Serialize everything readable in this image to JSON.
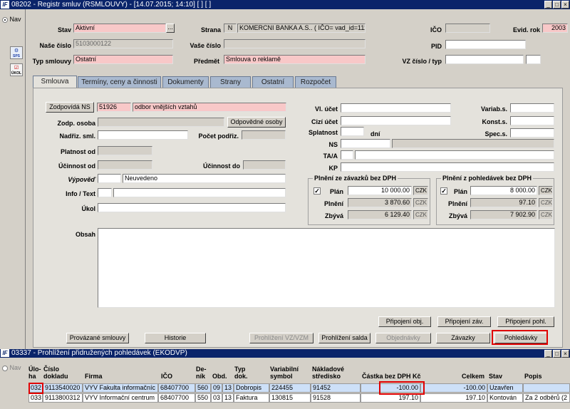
{
  "window": {
    "title": "08202 - Registr smluv (RSMLOUVY) - [14.07.2015; 14:10]  [ ]  [ ]",
    "logo": "IF"
  },
  "left": {
    "nav_label": "Nav",
    "icons": [
      {
        "name": "SPS",
        "label": "SPS"
      },
      {
        "name": "ukol",
        "label": "ÚKOL"
      }
    ]
  },
  "header": {
    "stav_label": "Stav",
    "stav_value": "Aktivní",
    "stav_button": "...",
    "strana_label": "Strana",
    "strana_code": "N",
    "strana_value": "KOMERCNI BANKA A.S.. ( IČO= vad_id=111524)",
    "ico_label": "IČO",
    "ico_value": "",
    "evid_rok_label": "Evid. rok",
    "evid_rok_value": "2003",
    "nase_cislo_label": "Naše číslo",
    "nase_cislo_value": "5103000122",
    "vase_cislo_label": "Vaše číslo",
    "vase_cislo_value": "",
    "pid_label": "PID",
    "pid_value": "",
    "typ_label": "Typ smlouvy",
    "typ_value": "Ostatní",
    "predmet_label": "Předmět",
    "predmet_value": "Smlouva o reklamě",
    "vz_label": "VZ číslo / typ",
    "vz_value": "",
    "vz_typ_value": ""
  },
  "tabs": [
    "Smlouva",
    "Termíny, ceny a činnosti",
    "Dokumenty",
    "Strany",
    "Ostatní",
    "Rozpočet"
  ],
  "form": {
    "zodpovida_button": "Zodpovídá NS",
    "zodpovida_code": "51926",
    "zodpovida_name": "odbor vnějších vztahů",
    "zodp_osoba_label": "Zodp. osoba",
    "zodp_osoba_value": "",
    "odpovedne_osoby_button": "Odpovědné osoby",
    "nadriz_label": "Nadřiz. sml.",
    "nadriz_value": "",
    "pocet_podriz_label": "Počet podřiz.",
    "pocet_podriz_value": "",
    "platnost_label": "Platnost od",
    "platnost_value": "",
    "ucinnost_od_label": "Účinnost od",
    "ucinnost_od_value": "",
    "ucinnost_do_label": "Účinnost do",
    "ucinnost_do_value": "",
    "vypoved_label": "Výpověď",
    "vypoved_code": "",
    "vypoved_value": "Neuvedeno",
    "info_label": "Info / Text",
    "info_code": "",
    "info_value": "",
    "ukol_label": "Úkol",
    "ukol_value": "",
    "obsah_label": "Obsah",
    "obsah_value": "",
    "vl_ucet_label": "Vl. účet",
    "vl_ucet_value": "",
    "cizi_ucet_label": "Cizí účet",
    "cizi_ucet_value": "",
    "splatnost_label": "Splatnost",
    "splatnost_value": "",
    "dni_label": "dní",
    "ns_label": "NS",
    "ns_value": "",
    "ns_name": "",
    "taa_label": "TA/A",
    "taa_code": "",
    "taa_value": "",
    "kp_label": "KP",
    "kp_value": "",
    "varias_label": "Variab.s.",
    "varias_value": "",
    "konst_label": "Konst.s.",
    "konst_value": "",
    "spec_label": "Spec.s.",
    "spec_value": ""
  },
  "plneni_zavazku": {
    "title": "Plnění ze závazků bez DPH",
    "plan_label": "Plán",
    "plan_value": "10 000.00",
    "plan_cur": "CZK",
    "plneni_label": "Plnění",
    "plneni_value": "3 870.60",
    "plneni_cur": "CZK",
    "zbyva_label": "Zbývá",
    "zbyva_value": "6 129.40",
    "zbyva_cur": "CZK",
    "checked": "✓"
  },
  "plneni_pohledavek": {
    "title": "Plnění z pohledávek bez DPH",
    "plan_label": "Plán",
    "plan_value": "8 000.00",
    "plan_cur": "CZK",
    "plneni_label": "Plnění",
    "plneni_value": "97.10",
    "plneni_cur": "CZK",
    "zbyva_label": "Zbývá",
    "zbyva_value": "7 902.90",
    "zbyva_cur": "CZK",
    "checked": "✓"
  },
  "buttons": {
    "pripojeni_obj": "Připojení obj.",
    "pripojeni_zav": "Připojení záv.",
    "pripojeni_pohl": "Připojení pohl.",
    "provazane": "Provázané smlouvy",
    "historie": "Historie",
    "prohlizeni_vz": "Prohlížení VZ/VZM",
    "prohlizeni_salda": "Prohlížení salda",
    "objednavky": "Objednávky",
    "zavazky": "Závazky",
    "pohledavky": "Pohledávky"
  },
  "window2": {
    "title": "03337 - Prohlížení přidružených pohledávek (EKODVP)",
    "nav_label": "Nav",
    "columns": [
      [
        "Úlo-",
        "ha"
      ],
      [
        "Číslo",
        "dokladu"
      ],
      [
        "",
        "Firma"
      ],
      [
        "",
        "IČO"
      ],
      [
        "De-",
        "ník"
      ],
      [
        "",
        "Obd."
      ],
      [
        "Typ",
        "dok."
      ],
      [
        "Variabilní",
        "symbol"
      ],
      [
        "Nákladové",
        "středisko"
      ],
      [
        "",
        "Částka bez DPH Kč"
      ],
      [
        "",
        "Celkem"
      ],
      [
        "",
        "Stav"
      ],
      [
        "",
        "Popis"
      ]
    ],
    "rows": [
      [
        "032",
        "9113540020",
        "VYV Fakulta informačníc",
        "68407700",
        "560",
        "09",
        "13",
        "Dobropis",
        "224455",
        "91452",
        "-100.00",
        "-100.00",
        "Uzavřen",
        ""
      ],
      [
        "033",
        "9113800312",
        "VYV Informační centrum",
        "68407700",
        "550",
        "03",
        "13",
        "Faktura",
        "130815",
        "91528",
        "197.10",
        "197.10",
        "Kontován",
        "Za 2 odběrů (2"
      ]
    ]
  }
}
